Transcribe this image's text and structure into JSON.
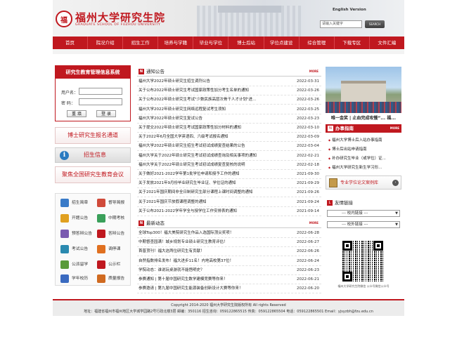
{
  "header": {
    "logo_seal": "福",
    "logo_cn": "福州大学研究生院",
    "logo_en": "GRADUATE SCHOOL OF FUZHOU UNIVERSITY",
    "english_version": "English Version",
    "search_placeholder": "请输入关键字",
    "search_button": "SEARCH"
  },
  "nav": [
    "首页",
    "院况介绍",
    "招生工作",
    "培养与学籍",
    "毕业与学位",
    "博士后站",
    "学位点建设",
    "综合管理",
    "下载专区",
    "文件汇编"
  ],
  "login": {
    "title": "研究生教育管理信息系统",
    "username_label": "用户名：",
    "password_label": "密 码：",
    "reset_button": "重 填",
    "login_button": "登 录"
  },
  "left_banners": {
    "phd_registration": "博士研究生报名通道",
    "admission_info": "招生信息",
    "conference": "聚焦全国研究生教育会议"
  },
  "quick_links": [
    "招生简章",
    "督导简报",
    "开题公告",
    "中期考核",
    "预答辩公告",
    "答辩公告",
    "考试公告",
    "调停课",
    "公派留学",
    "公示栏",
    "学年校历",
    "质量报告"
  ],
  "quick_link_colors": [
    "#3a7bc8",
    "#d04a3a",
    "#e0a020",
    "#3aa05a",
    "#7a5ab0",
    "#c0181f",
    "#2a8ab0",
    "#e07020",
    "#5a9a3a",
    "#c0181f",
    "#3a6ac0",
    "#d06a20"
  ],
  "notices": {
    "title": "通知公告",
    "more": "MORE",
    "items": [
      {
        "title": "福州大学2022年硕士研究生招生调剂公告",
        "date": "2022-03-31"
      },
      {
        "title": "关于公布2022年硕士研究生考试国家政策性加分考生名单的通知",
        "date": "2022-03-26"
      },
      {
        "title": "关于公布2022年硕士研究生考试\"少数民族高层次骨干人才计划\"进...",
        "date": "2022-03-26"
      },
      {
        "title": "福州大学2022年硕士研究生网络远程复试考生须知",
        "date": "2022-03-25"
      },
      {
        "title": "福州大学2022年硕士研究生复试公告",
        "date": "2022-03-23"
      },
      {
        "title": "关于提交2022年硕士研究生考试国家政策性加分材料的通知",
        "date": "2022-03-10"
      },
      {
        "title": "关于2022年6月全国大学英语四、六级考试报名通知",
        "date": "2022-03-09"
      },
      {
        "title": "福州大学2022年硕士研究生招生考试初试成绩复查结果的公告",
        "date": "2022-03-04"
      },
      {
        "title": "福州大学关于2022年硕士研究生考试初试成绩查询及相关事项的通知",
        "date": "2022-02-21"
      },
      {
        "title": "福州大学关于2022年硕士研究生考试初试成绩复查复核的说明",
        "date": "2022-02-18"
      },
      {
        "title": "关于做好2021-2022学年第1批学位申请和授予工作的通知",
        "date": "2021-09-30"
      },
      {
        "title": "关于发放2021年9月份毕业研究生毕业证、学位证的通知",
        "date": "2021-09-29"
      },
      {
        "title": "关于2021年国庆期间非全日制研究生部分课程上课时间调整的通知",
        "date": "2021-09-26"
      },
      {
        "title": "关于2021年国庆节放假课程调整的通知",
        "date": "2021-09-24"
      },
      {
        "title": "关于公布2021-2022学年学全与授学位工作安排表的通知",
        "date": "2021-09-14"
      }
    ]
  },
  "news": {
    "title": "最新动态",
    "more": "MORE",
    "items": [
      {
        "title": "全球Top300！福大美院研究生作品入选国际顶尖奖项！",
        "date": "2022-06-28"
      },
      {
        "title": "中期督查园满！城乡规划专业硕士研究生教育评估！",
        "date": "2022-06-27"
      },
      {
        "title": "首普顶刊！福大这两位研究生有贡献！",
        "date": "2022-06-26"
      },
      {
        "title": "自然指数排名发布！福大进步11名！内地高校第37位！",
        "date": "2022-06-24"
      },
      {
        "title": "学院动态：谁说玩桌游就不能悟明史？",
        "date": "2022-06-23"
      },
      {
        "title": "参赛通知 | 第十届中国研究生数学建模竞赛等你来！",
        "date": "2022-06-21"
      },
      {
        "title": "参赛邀请 | 第九届中国研究生能源装备创新设计大赛等你来！",
        "date": "2022-06-20"
      }
    ]
  },
  "right": {
    "photo_caption": "唯一金奖 | 止血完成攻慢”... 福...",
    "office_title": "办事指南",
    "office_more": "MORE",
    "office_items": [
      "福州大学博士后入站办事指南",
      "博士后出站申请指南",
      "补办研究生毕业（或学位）证...",
      "福州大学研究生新生学习形..."
    ],
    "database_banner": "专业学位论文案例库",
    "links_title": "友情链接",
    "select_1": "--- 校内链接 ---",
    "select_2": "--- 校外链接 ---",
    "qr_caption": "福州大学研究生院微信\n公众号微信公众号"
  },
  "footer": {
    "copyright": "Copyright 2014-2020 福州大学研究生院版权所有 All rights Reserved",
    "address": "地址：福建省福州市福州地区大学城学园路2号行政北楼3层 邮编：350116 招生咨询：059122865515 传真：059122865504 电话：059122865501 Email：yjsyzbh@fzu.edu.cn"
  }
}
